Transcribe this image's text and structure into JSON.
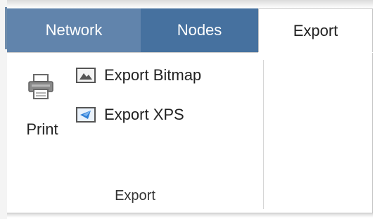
{
  "tabs": [
    {
      "label": "Network",
      "active": false
    },
    {
      "label": "Nodes",
      "active": false
    },
    {
      "label": "Export",
      "active": true
    }
  ],
  "export_group": {
    "print_label": "Print",
    "export_bitmap_label": "Export Bitmap",
    "export_xps_label": "Export XPS",
    "group_label": "Export"
  },
  "icons": {
    "print": "printer-icon",
    "bitmap": "image-icon",
    "xps": "xps-document-icon"
  },
  "colors": {
    "tab_network_bg": "#6184ac",
    "tab_nodes_bg": "#46719f",
    "tab_active_bg": "#ffffff"
  }
}
